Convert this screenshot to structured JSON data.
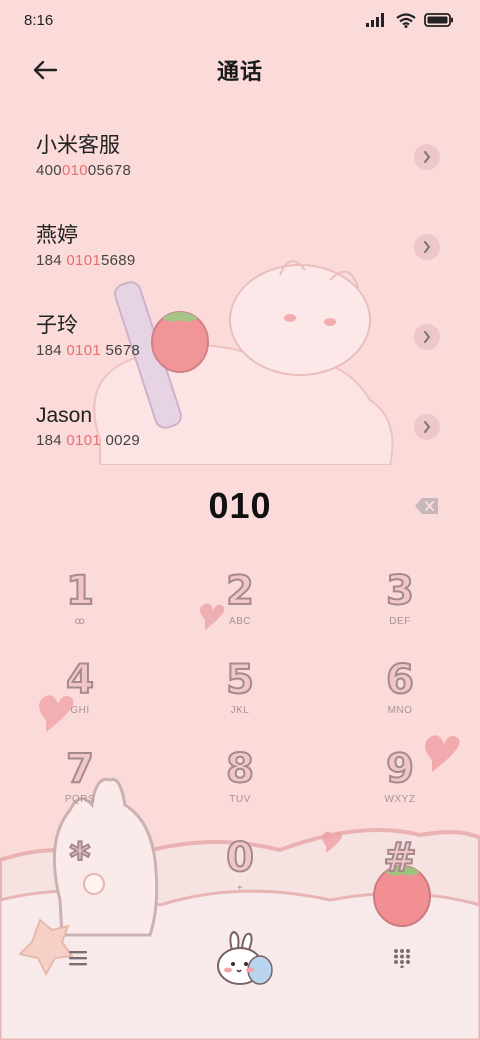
{
  "status_bar": {
    "time": "8:16"
  },
  "header": {
    "title": "通话"
  },
  "contacts": [
    {
      "name": "小米客服",
      "number_pre": "400",
      "number_match": "010",
      "number_post": "05678"
    },
    {
      "name": "燕婷",
      "number_pre": "184 ",
      "number_match": "0101",
      "number_post": "5689"
    },
    {
      "name": "子玲",
      "number_pre": "184 ",
      "number_match": "0101",
      "number_post": " 5678"
    },
    {
      "name": "Jason",
      "number_pre": "184 ",
      "number_match": "0101",
      "number_post": " 0029"
    }
  ],
  "dialer": {
    "number": "010"
  },
  "keypad": [
    {
      "digit": "1",
      "letters": "ꝏ"
    },
    {
      "digit": "2",
      "letters": "ABC"
    },
    {
      "digit": "3",
      "letters": "DEF"
    },
    {
      "digit": "4",
      "letters": "GHI"
    },
    {
      "digit": "5",
      "letters": "JKL"
    },
    {
      "digit": "6",
      "letters": "MNO"
    },
    {
      "digit": "7",
      "letters": "PQRS"
    },
    {
      "digit": "8",
      "letters": "TUV"
    },
    {
      "digit": "9",
      "letters": "WXYZ"
    },
    {
      "digit": "*",
      "letters": ""
    },
    {
      "digit": "0",
      "letters": "+"
    },
    {
      "digit": "#",
      "letters": ""
    }
  ],
  "bottom_bar": {
    "menu_icon": "menu-icon",
    "call_icon": "bunny-call-icon",
    "grid_icon": "dialpad-icon"
  },
  "colors": {
    "background": "#fbdada",
    "match_highlight": "#e7706f",
    "key_outline": "#a48a8f"
  }
}
